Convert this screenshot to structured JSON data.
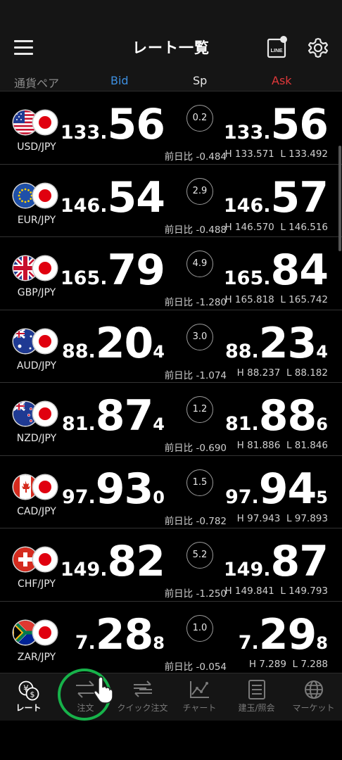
{
  "header": {
    "title": "レート一覧",
    "line_label": "LINE"
  },
  "columns": {
    "pair": "通貨ペア",
    "bid": "Bid",
    "sp": "Sp",
    "ask": "Ask"
  },
  "colors": {
    "bid": "#3d8fe0",
    "ask": "#e0383a",
    "accent_ring": "#17b24a"
  },
  "rows": [
    {
      "pair": "USD/JPY",
      "base_flag": "us-flag-icon",
      "bid_small": "133.",
      "bid_big": "56",
      "bid_pip": "",
      "spread": "0.2",
      "ask_small": "133.",
      "ask_big": "56",
      "ask_pip": "",
      "change": "前日比 -0.484",
      "high": "H 133.571",
      "low": "L 133.492",
      "tick": ""
    },
    {
      "pair": "EUR/JPY",
      "base_flag": "eu-flag-icon",
      "bid_small": "146.",
      "bid_big": "54",
      "bid_pip": "",
      "spread": "2.9",
      "ask_small": "146.",
      "ask_big": "57",
      "ask_pip": "",
      "change": "前日比 -0.488",
      "high": "H 146.570",
      "low": "L 146.516",
      "tick": ""
    },
    {
      "pair": "GBP/JPY",
      "base_flag": "uk-flag-icon",
      "bid_small": "165.",
      "bid_big": "79",
      "bid_pip": "",
      "spread": "4.9",
      "ask_small": "165.",
      "ask_big": "84",
      "ask_pip": "",
      "change": "前日比 -1.280",
      "high": "H 165.818",
      "low": "L 165.742",
      "tick": "down"
    },
    {
      "pair": "AUD/JPY",
      "base_flag": "au-flag-icon",
      "bid_small": "88.",
      "bid_big": "20",
      "bid_pip": "4",
      "spread": "3.0",
      "ask_small": "88.",
      "ask_big": "23",
      "ask_pip": "4",
      "change": "前日比 -1.074",
      "high": "H 88.237",
      "low": "L 88.182",
      "tick": "up"
    },
    {
      "pair": "NZD/JPY",
      "base_flag": "nz-flag-icon",
      "bid_small": "81.",
      "bid_big": "87",
      "bid_pip": "4",
      "spread": "1.2",
      "ask_small": "81.",
      "ask_big": "88",
      "ask_pip": "6",
      "change": "前日比 -0.690",
      "high": "H 81.886",
      "low": "L 81.846",
      "tick": ""
    },
    {
      "pair": "CAD/JPY",
      "base_flag": "ca-flag-icon",
      "bid_small": "97.",
      "bid_big": "93",
      "bid_pip": "0",
      "spread": "1.5",
      "ask_small": "97.",
      "ask_big": "94",
      "ask_pip": "5",
      "change": "前日比 -0.782",
      "high": "H 97.943",
      "low": "L 97.893",
      "tick": ""
    },
    {
      "pair": "CHF/JPY",
      "base_flag": "ch-flag-icon",
      "bid_small": "149.",
      "bid_big": "82",
      "bid_pip": "",
      "spread": "5.2",
      "ask_small": "149.",
      "ask_big": "87",
      "ask_pip": "",
      "change": "前日比 -1.250",
      "high": "H 149.841",
      "low": "L 149.793",
      "tick": "down"
    },
    {
      "pair": "ZAR/JPY",
      "base_flag": "za-flag-icon",
      "bid_small": "7.",
      "bid_big": "28",
      "bid_pip": "8",
      "spread": "1.0",
      "ask_small": "7.",
      "ask_big": "29",
      "ask_pip": "8",
      "change": "前日比 -0.054",
      "high": "H 7.289",
      "low": "L 7.288",
      "tick": ""
    }
  ],
  "nav": [
    {
      "label": "レート",
      "icon": "rate-icon",
      "active": true
    },
    {
      "label": "注文",
      "icon": "order-icon",
      "active": false
    },
    {
      "label": "クイック注文",
      "icon": "quick-order-icon",
      "active": false
    },
    {
      "label": "チャート",
      "icon": "chart-icon",
      "active": false
    },
    {
      "label": "建玉/照会",
      "icon": "position-icon",
      "active": false
    },
    {
      "label": "マーケット",
      "icon": "market-icon",
      "active": false
    }
  ]
}
